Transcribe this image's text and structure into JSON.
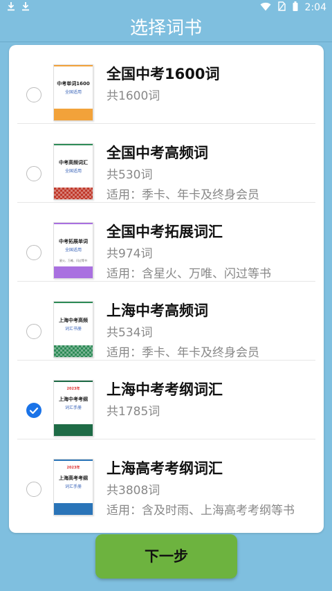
{
  "status_bar": {
    "time": "2:04",
    "icons": [
      "download-icon",
      "download-icon",
      "wifi-icon",
      "no-sim-icon",
      "battery-icon"
    ]
  },
  "header": {
    "title": "选择词书"
  },
  "books": [
    {
      "name": "全国中考1600词",
      "count": "共1600词",
      "note": "",
      "selected": false,
      "cover": {
        "title": "中考单词1600",
        "subtitle": "全国适用",
        "year": "",
        "band_color": "#f2a23a",
        "line_color": "#f2a23a",
        "pattern": false,
        "cover_note": ""
      }
    },
    {
      "name": "全国中考高频词",
      "count": "共530词",
      "note": "适用：季卡、年卡及终身会员",
      "selected": false,
      "cover": {
        "title": "中考高频词汇",
        "subtitle": "全国适用",
        "year": "",
        "band_color": "#c0392b",
        "line_color": "#2e8b57",
        "pattern": true,
        "cover_note": ""
      }
    },
    {
      "name": "全国中考拓展词汇",
      "count": "共974词",
      "note": "适用：含星火、万唯、闪过等书",
      "selected": false,
      "cover": {
        "title": "中考拓展单词",
        "subtitle": "全国适用",
        "year": "",
        "band_color": "#a970e0",
        "line_color": "#a970e0",
        "pattern": false,
        "cover_note": "星火、万唯、闪过等书"
      }
    },
    {
      "name": "上海中考高频词",
      "count": "共534词",
      "note": "适用：季卡、年卡及终身会员",
      "selected": false,
      "cover": {
        "title": "上海中考高频",
        "subtitle": "词汇书册",
        "year": "",
        "band_color": "#2e8b57",
        "line_color": "#2e8b57",
        "pattern": true,
        "cover_note": ""
      }
    },
    {
      "name": "上海中考考纲词汇",
      "count": "共1785词",
      "note": "",
      "selected": true,
      "cover": {
        "title": "上海中考考纲",
        "subtitle": "词汇手册",
        "year": "2023年",
        "band_color": "#1e6b46",
        "line_color": "#1e6b46",
        "pattern": false,
        "cover_note": ""
      }
    },
    {
      "name": "上海高考考纲词汇",
      "count": "共3808词",
      "note": "适用：含及时雨、上海高考考纲等书",
      "selected": false,
      "cover": {
        "title": "上海高考考纲",
        "subtitle": "词汇手册",
        "year": "2023年",
        "band_color": "#2a74b8",
        "line_color": "#2a74b8",
        "pattern": false,
        "cover_note": ""
      }
    }
  ],
  "footer": {
    "next_label": "下一步"
  },
  "colors": {
    "background": "#7fbfdf",
    "accent": "#1a73e8",
    "button": "#6db33f"
  }
}
